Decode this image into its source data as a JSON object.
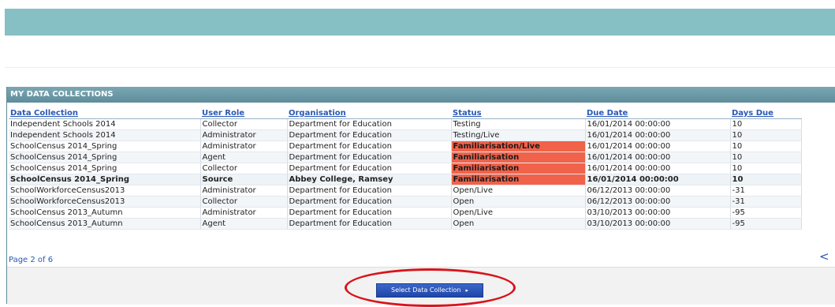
{
  "panel": {
    "title": "MY DATA COLLECTIONS"
  },
  "table": {
    "headers": [
      "Data Collection",
      "User Role",
      "Organisation",
      "Status",
      "Due Date",
      "Days Due"
    ],
    "rows": [
      {
        "collection": "Independent Schools 2014",
        "role": "Collector",
        "org": "Department for Education",
        "status": "Testing",
        "due": "16/01/2014 00:00:00",
        "days": "10"
      },
      {
        "collection": "Independent Schools 2014",
        "role": "Administrator",
        "org": "Department for Education",
        "status": "Testing/Live",
        "due": "16/01/2014 00:00:00",
        "days": "10"
      },
      {
        "collection": "SchoolCensus 2014_Spring",
        "role": "Administrator",
        "org": "Department for Education",
        "status": "Familiarisation/Live",
        "due": "16/01/2014 00:00:00",
        "days": "10"
      },
      {
        "collection": "SchoolCensus 2014_Spring",
        "role": "Agent",
        "org": "Department for Education",
        "status": "Familiarisation",
        "due": "16/01/2014 00:00:00",
        "days": "10"
      },
      {
        "collection": "SchoolCensus 2014_Spring",
        "role": "Collector",
        "org": "Department for Education",
        "status": "Familiarisation",
        "due": "16/01/2014 00:00:00",
        "days": "10"
      },
      {
        "collection": "SchoolCensus 2014_Spring",
        "role": "Source",
        "org": "Abbey College, Ramsey",
        "status": "Familiarisation",
        "due": "16/01/2014 00:00:00",
        "days": "10"
      },
      {
        "collection": "SchoolWorkforceCensus2013",
        "role": "Administrator",
        "org": "Department for Education",
        "status": "Open/Live",
        "due": "06/12/2013 00:00:00",
        "days": "-31"
      },
      {
        "collection": "SchoolWorkforceCensus2013",
        "role": "Collector",
        "org": "Department for Education",
        "status": "Open",
        "due": "06/12/2013 00:00:00",
        "days": "-31"
      },
      {
        "collection": "SchoolCensus 2013_Autumn",
        "role": "Administrator",
        "org": "Department for Education",
        "status": "Open/Live",
        "due": "03/10/2013 00:00:00",
        "days": "-95"
      },
      {
        "collection": "SchoolCensus 2013_Autumn",
        "role": "Agent",
        "org": "Department for Education",
        "status": "Open",
        "due": "03/10/2013 00:00:00",
        "days": "-95"
      }
    ]
  },
  "pager": {
    "text": "Page 2 of 6",
    "nav": "< >"
  },
  "footer": {
    "select_button_label": "Select Data Collection",
    "select_button_arrow": "▸"
  },
  "colors": {
    "banner": "#86bfc4",
    "status_highlight": "#f0624a",
    "annotation_circle": "#d8141c"
  }
}
